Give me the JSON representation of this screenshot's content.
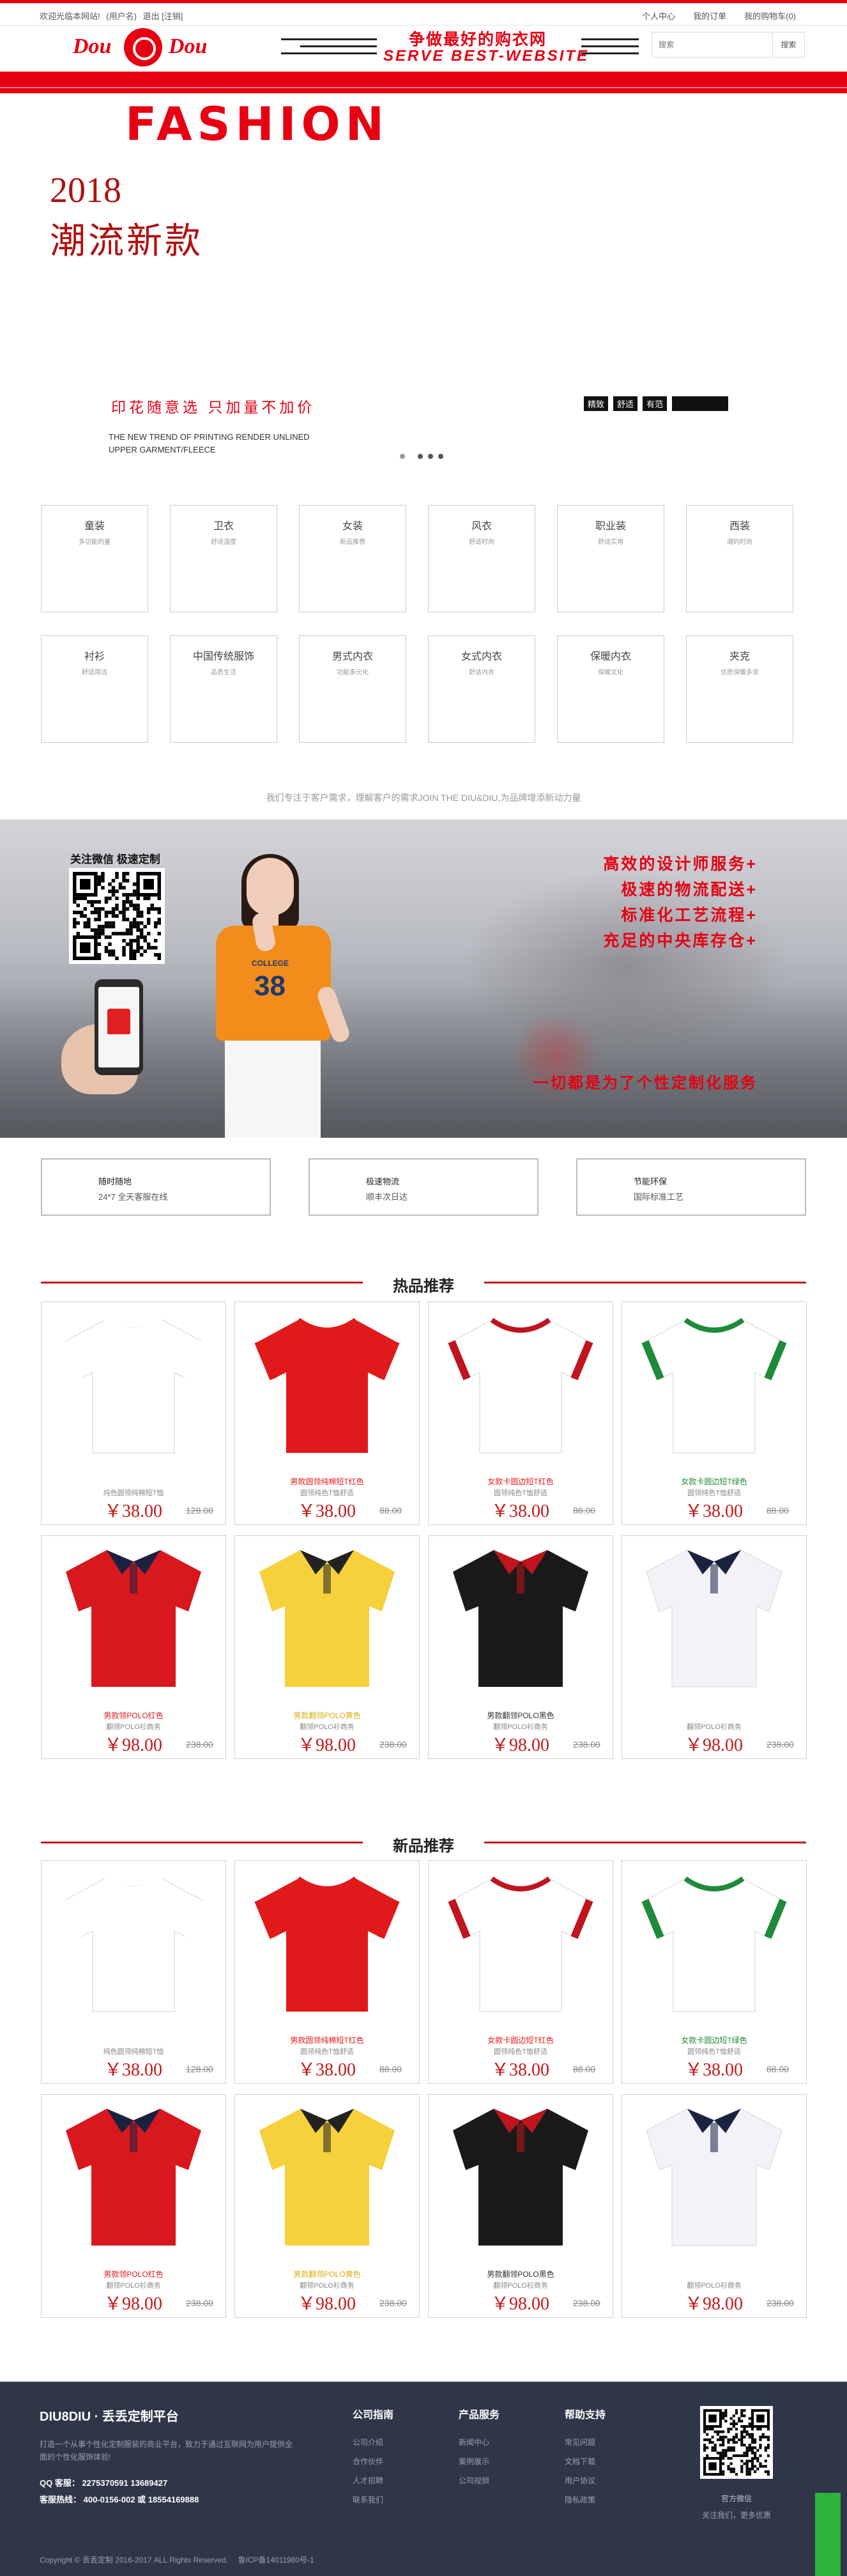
{
  "topbar": {
    "welcome": "欢迎光临本网站!",
    "login_link": "(用户名)",
    "logout_link": "退出 [注销]",
    "links": [
      "个人中心",
      "我的订单",
      "我的购物车(0)"
    ]
  },
  "header": {
    "logo_left": "Dou",
    "logo_right": "Dou",
    "slogan_cn": "争做最好的购衣网",
    "slogan_en": "SERVE BEST-WEBSITE",
    "search_placeholder": "搜索",
    "search_button": "搜索"
  },
  "banner": {
    "headline": "FASHION",
    "year": "2018",
    "title": "潮流新款",
    "tagline": "印花随意选  只加量不加价",
    "en_line1": "THE NEW TREND OF PRINTING RENDER UNLINED",
    "en_line2": "UPPER GARMENT/FLEECE",
    "tags": [
      "精致",
      "舒适",
      "有范",
      ""
    ]
  },
  "categories": [
    {
      "name": "童装",
      "sub": "多功能的童"
    },
    {
      "name": "卫衣",
      "sub": "舒适温度"
    },
    {
      "name": "女装",
      "sub": "新品推荐"
    },
    {
      "name": "风衣",
      "sub": "舒适时尚"
    },
    {
      "name": "职业装",
      "sub": "舒适实用"
    },
    {
      "name": "西装",
      "sub": "潮的时尚"
    },
    {
      "name": "衬衫",
      "sub": "舒适简洁"
    },
    {
      "name": "中国传统服饰",
      "sub": "品质生活"
    },
    {
      "name": "男式内衣",
      "sub": "功能多元化"
    },
    {
      "name": "女式内衣",
      "sub": "舒适内衣"
    },
    {
      "name": "保暖内衣",
      "sub": "保暖文化"
    },
    {
      "name": "夹克",
      "sub": "优质保暖多变"
    }
  ],
  "promise": "我们专注于客户需求，理解客户的需求JOIN THE DIU&DIU,为品牌增添新动力量",
  "service": {
    "wechat_label": "关注微信 极速定制",
    "college_text": "COLLEGE",
    "number": "38",
    "items": [
      "高效的设计师服务+",
      "极速的物流配送+",
      "标准化工艺流程+",
      "充足的中央库存仓+"
    ],
    "motto": "一切都是为了个性定制化服务"
  },
  "features": [
    {
      "title": "随时随地",
      "desc": "24*7 全天客服在线"
    },
    {
      "title": "极速物流",
      "desc": "顺丰次日达"
    },
    {
      "title": "节能环保",
      "desc": "国际标准工艺"
    }
  ],
  "sections": [
    {
      "title": "热品推荐",
      "products": [
        {
          "name": "",
          "desc": "纯色圆领纯棉短T恤",
          "price": "￥38.00",
          "old": "128.00",
          "color": "#ffffff",
          "trim": "#ffffff",
          "kind": "tee",
          "name_color": "#888888"
        },
        {
          "name": "男款圆领纯棉短T红色",
          "desc": "圆领纯色T恤舒适",
          "price": "￥38.00",
          "old": "88.00",
          "color": "#e01a1a",
          "trim": "#e01a1a",
          "kind": "tee",
          "name_color": "#e01a1a"
        },
        {
          "name": "女款卡圆边短T红色",
          "desc": "圆领纯色T恤舒适",
          "price": "￥38.00",
          "old": "88.00",
          "color": "#ffffff",
          "trim": "#c0141e",
          "kind": "tee",
          "name_color": "#e01a1a"
        },
        {
          "name": "女款卡圆边短T绿色",
          "desc": "圆领纯色T恤舒适",
          "price": "￥38.00",
          "old": "88.00",
          "color": "#ffffff",
          "trim": "#1f8a3a",
          "kind": "tee",
          "name_color": "#1f8a3a"
        },
        {
          "name": "男款领POLO红色",
          "desc": "翻领POLO衫商务",
          "price": "￥98.00",
          "old": "238.00",
          "color": "#d8171e",
          "trim": "#1a2240",
          "kind": "polo",
          "name_color": "#e01a1a"
        },
        {
          "name": "男款翻领POLO黄色",
          "desc": "翻领POLO衫商务",
          "price": "￥98.00",
          "old": "238.00",
          "color": "#f6d13c",
          "trim": "#222222",
          "kind": "polo",
          "name_color": "#d8b010"
        },
        {
          "name": "男款翻领POLO黑色",
          "desc": "翻领POLO衫商务",
          "price": "￥98.00",
          "old": "238.00",
          "color": "#1a1a1a",
          "trim": "#c0141e",
          "kind": "polo",
          "name_color": "#333333"
        },
        {
          "name": "",
          "desc": "翻领POLO衫商务",
          "price": "￥98.00",
          "old": "238.00",
          "color": "#f4f2f8",
          "trim": "#1a2240",
          "kind": "polo",
          "name_color": "#888888"
        }
      ]
    },
    {
      "title": "新品推荐",
      "products": [
        {
          "name": "",
          "desc": "纯色圆领纯棉短T恤",
          "price": "￥38.00",
          "old": "128.00",
          "color": "#ffffff",
          "trim": "#ffffff",
          "kind": "tee",
          "name_color": "#888888"
        },
        {
          "name": "男款圆领纯棉短T红色",
          "desc": "圆领纯色T恤舒适",
          "price": "￥38.00",
          "old": "88.00",
          "color": "#e01a1a",
          "trim": "#e01a1a",
          "kind": "tee",
          "name_color": "#e01a1a"
        },
        {
          "name": "女款卡圆边短T红色",
          "desc": "圆领纯色T恤舒适",
          "price": "￥38.00",
          "old": "88.00",
          "color": "#ffffff",
          "trim": "#c0141e",
          "kind": "tee",
          "name_color": "#e01a1a"
        },
        {
          "name": "女款卡圆边短T绿色",
          "desc": "圆领纯色T恤舒适",
          "price": "￥38.00",
          "old": "88.00",
          "color": "#ffffff",
          "trim": "#1f8a3a",
          "kind": "tee",
          "name_color": "#1f8a3a"
        },
        {
          "name": "男款领POLO红色",
          "desc": "翻领POLO衫商务",
          "price": "￥98.00",
          "old": "238.00",
          "color": "#d8171e",
          "trim": "#1a2240",
          "kind": "polo",
          "name_color": "#e01a1a"
        },
        {
          "name": "男款翻领POLO黄色",
          "desc": "翻领POLO衫商务",
          "price": "￥98.00",
          "old": "238.00",
          "color": "#f6d13c",
          "trim": "#222222",
          "kind": "polo",
          "name_color": "#d8b010"
        },
        {
          "name": "男款翻领POLO黑色",
          "desc": "翻领POLO衫商务",
          "price": "￥98.00",
          "old": "238.00",
          "color": "#1a1a1a",
          "trim": "#c0141e",
          "kind": "polo",
          "name_color": "#333333"
        },
        {
          "name": "",
          "desc": "翻领POLO衫商务",
          "price": "￥98.00",
          "old": "238.00",
          "color": "#f4f2f8",
          "trim": "#1a2240",
          "kind": "polo",
          "name_color": "#888888"
        }
      ]
    }
  ],
  "footer": {
    "brand": "DIU8DIU · 丢丢定制平台",
    "intro": "打造一个从事个性化定制服装的商业平台，致力于通过互联网为用户提供全面的个性化服饰体验!",
    "qq": "QQ 客服：  2275370591 13689427",
    "phone": "客服热线：  400-0156-002 或 18554169888",
    "columns": [
      {
        "title": "公司指南",
        "items": [
          "公司介绍",
          "合作伙伴",
          "人才招聘",
          "联系我们"
        ]
      },
      {
        "title": "产品服务",
        "items": [
          "新闻中心",
          "案例展示",
          "公司视频"
        ]
      },
      {
        "title": "帮助支持",
        "items": [
          "常见问题",
          "文档下载",
          "用户协议",
          "隐私政策"
        ]
      }
    ],
    "qr_label": "官方微信",
    "qr_sub": "关注我们，更多优惠",
    "copyright": "Copyright © 丢丢定制 2016-2017 ALL Rights Reserved.",
    "icp": "鲁ICP备14011980号-1"
  },
  "colors": {
    "accent": "#e60012",
    "footer_bg": "#2e3648",
    "green_tab": "#2db53b"
  }
}
